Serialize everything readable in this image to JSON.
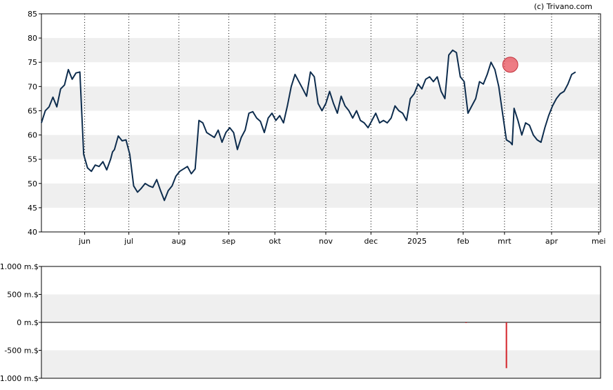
{
  "credit": "(c) Trivano.com",
  "chart_data": [
    {
      "type": "line",
      "title": "",
      "xlabel": "",
      "ylabel": "",
      "ylim": [
        40,
        85
      ],
      "yticks": [
        "40",
        "45",
        "50",
        "55",
        "60",
        "65",
        "70",
        "75",
        "80",
        "85"
      ],
      "x_tick_labels": [
        "jun",
        "jul",
        "aug",
        "sep",
        "okt",
        "nov",
        "dec",
        "2025",
        "feb",
        "mrt",
        "apr",
        "mei"
      ],
      "grid": "alternating horizontal bands, dotted vertical month lines",
      "line_color": "#0d2c4d",
      "marker": {
        "x": 244,
        "y": 74.5,
        "color": "#e8505b"
      },
      "x": [
        0,
        2,
        4,
        6,
        8,
        10,
        12,
        14,
        16,
        18,
        20,
        22,
        24,
        26,
        28,
        30,
        32,
        34,
        36,
        37,
        38,
        40,
        42,
        44,
        46,
        48,
        50,
        52,
        54,
        56,
        58,
        60,
        62,
        64,
        66,
        68,
        70,
        72,
        74,
        76,
        78,
        80,
        82,
        84,
        86,
        88,
        90,
        92,
        94,
        96,
        98,
        100,
        102,
        104,
        106,
        108,
        110,
        112,
        114,
        116,
        118,
        120,
        122,
        124,
        126,
        128,
        130,
        132,
        134,
        136,
        138,
        140,
        142,
        144,
        146,
        148,
        150,
        152,
        154,
        156,
        158,
        160,
        162,
        164,
        166,
        168,
        170,
        172,
        174,
        176,
        178,
        180,
        182,
        184,
        186,
        188,
        190,
        192,
        194,
        196,
        198,
        200,
        202,
        204,
        206,
        208,
        210,
        212,
        214,
        216,
        218,
        220,
        222,
        224,
        226,
        228,
        230,
        232,
        234,
        236,
        238,
        240,
        242,
        244,
        245,
        246,
        248,
        250,
        252,
        254,
        256,
        258,
        260,
        262,
        264,
        266,
        268,
        270,
        272,
        274,
        276,
        278,
        280,
        282,
        284,
        286,
        288,
        290,
        291
      ],
      "values": [
        62.5,
        65.0,
        65.8,
        67.8,
        65.8,
        69.5,
        70.3,
        73.5,
        71.5,
        72.8,
        73.0,
        56.0,
        53.2,
        52.5,
        53.8,
        53.5,
        54.5,
        52.8,
        55.0,
        56.5,
        57.0,
        59.8,
        58.8,
        59.0,
        56.0,
        49.5,
        48.2,
        49.0,
        50.0,
        49.5,
        49.2,
        50.8,
        48.5,
        46.5,
        48.5,
        49.5,
        51.5,
        52.5,
        53.0,
        53.5,
        52.0,
        53.0,
        63.0,
        62.5,
        60.5,
        60.0,
        59.5,
        61.0,
        58.5,
        60.5,
        61.5,
        60.5,
        57.0,
        59.5,
        61.0,
        64.5,
        64.8,
        63.5,
        62.8,
        60.5,
        63.5,
        64.5,
        63.0,
        64.0,
        62.5,
        66.0,
        70.0,
        72.5,
        71.0,
        69.5,
        68.0,
        73.0,
        72.0,
        66.5,
        65.0,
        66.5,
        69.0,
        66.5,
        64.5,
        68.0,
        66.0,
        65.0,
        63.5,
        65.0,
        63.0,
        62.5,
        61.5,
        63.0,
        64.5,
        62.5,
        63.0,
        62.5,
        63.5,
        66.0,
        65.0,
        64.5,
        63.0,
        67.5,
        68.5,
        70.5,
        69.5,
        71.5,
        72.0,
        71.0,
        72.0,
        69.0,
        67.5,
        76.5,
        77.5,
        77.0,
        72.0,
        71.0,
        64.5,
        66.0,
        67.5,
        71.0,
        70.5,
        72.5,
        75.0,
        73.5,
        70.0,
        64.5,
        59.0,
        58.5,
        58.0,
        65.5,
        63.0,
        60.0,
        62.5,
        62.0,
        60.0,
        59.0,
        58.5,
        61.5,
        64.0,
        66.0,
        67.5,
        68.5,
        69.0,
        70.5,
        72.5,
        73.0
      ]
    },
    {
      "type": "bar",
      "title": "",
      "xlabel": "",
      "ylabel": "",
      "ylim": [
        -1000,
        1000
      ],
      "yticks": [
        "-1.000 m.$",
        "-500 m.$",
        "0 m.$",
        "500 m.$",
        "1.000 m.$"
      ],
      "bar_color": "#d42027",
      "x": [
        221,
        242
      ],
      "values": [
        -5,
        -820
      ]
    }
  ]
}
